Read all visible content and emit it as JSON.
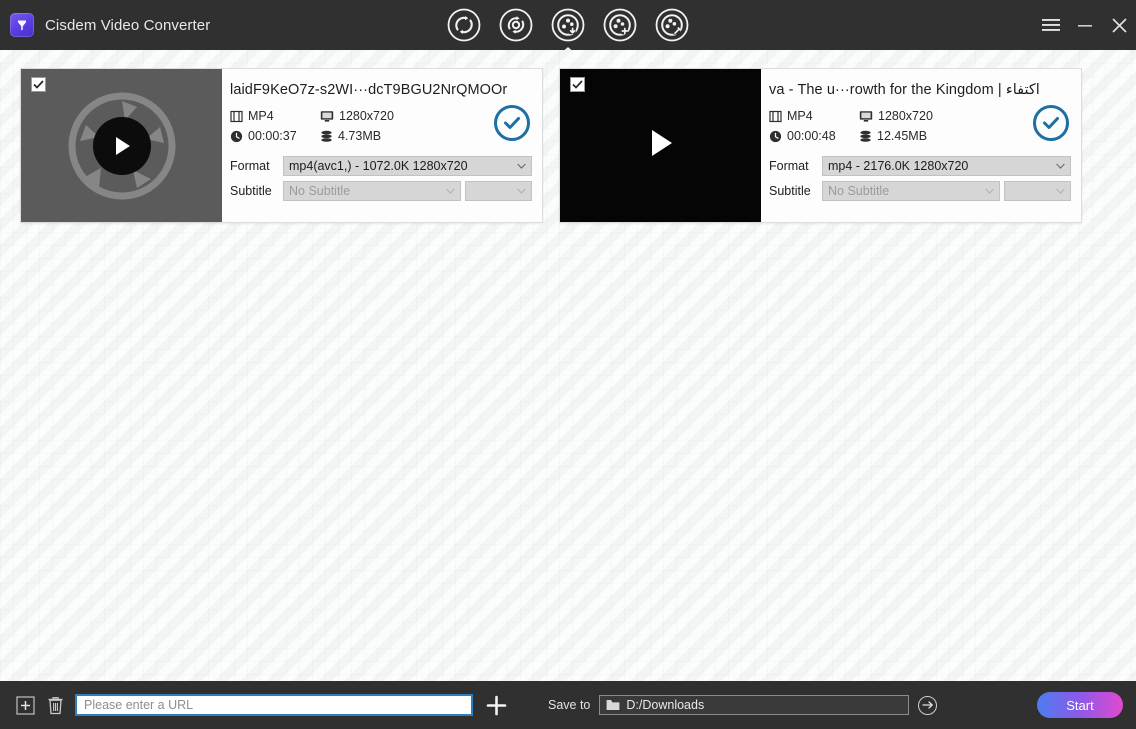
{
  "window": {
    "app_title": "Cisdem Video Converter",
    "logo_icon": "cisdem-logo-icon",
    "controls": {
      "menu_label": "menu-icon",
      "minimize_label": "minimize-icon",
      "close_label": "close-icon"
    }
  },
  "toolbar": {
    "tabs": [
      {
        "id": "convert",
        "icon": "convert-arrows-circle-icon",
        "active": false
      },
      {
        "id": "compress",
        "icon": "compress-circle-icon",
        "active": false
      },
      {
        "id": "download",
        "icon": "film-reel-download-icon",
        "active": true
      },
      {
        "id": "edit",
        "icon": "film-reel-edit-icon",
        "active": false
      },
      {
        "id": "tools",
        "icon": "film-reel-tools-icon",
        "active": false
      }
    ]
  },
  "cards": [
    {
      "checkbox_checked": true,
      "thumbnail_style": "gray-placeholder-reel",
      "play_icon": "play-button-circle-icon",
      "title": "laidF9KeO7z-s2WI···dcT9BGU2NrQMOOr",
      "format_type": "MP4",
      "resolution": "1280x720",
      "duration": "00:00:37",
      "filesize": "4.73MB",
      "status_icon": "check-circle-icon",
      "format_label": "Format",
      "format_value": "mp4(avc1,) - 1072.0K 1280x720",
      "subtitle_label": "Subtitle",
      "subtitle_value": "No Subtitle",
      "subtitle_extra_value": ""
    },
    {
      "checkbox_checked": true,
      "thumbnail_style": "black",
      "play_icon": "play-triangle-icon",
      "title": "va - The u···rowth for the Kingdom | اكتفاء",
      "format_type": "MP4",
      "resolution": "1280x720",
      "duration": "00:00:48",
      "filesize": "12.45MB",
      "status_icon": "check-circle-icon",
      "format_label": "Format",
      "format_value": "mp4 - 2176.0K 1280x720",
      "subtitle_label": "Subtitle",
      "subtitle_value": "No Subtitle",
      "subtitle_extra_value": ""
    }
  ],
  "bottom": {
    "add_file_icon": "add-file-box-icon",
    "delete_icon": "trash-icon",
    "url_placeholder": "Please enter a URL",
    "url_value": "",
    "add_url_icon": "plus-icon",
    "save_to_label": "Save to",
    "save_path": "D:/Downloads",
    "folder_icon": "folder-icon",
    "go_icon": "arrow-right-circle-icon",
    "start_label": "Start"
  },
  "colors": {
    "titlebar_bg": "#303030",
    "main_bg": "#f6f7f8",
    "accent_blue": "#1d6fa5",
    "focus_blue": "#2d7fc2",
    "start_gradient_from": "#4d7df0",
    "start_gradient_mid": "#8a5ae8",
    "start_gradient_to": "#e04ad0"
  }
}
